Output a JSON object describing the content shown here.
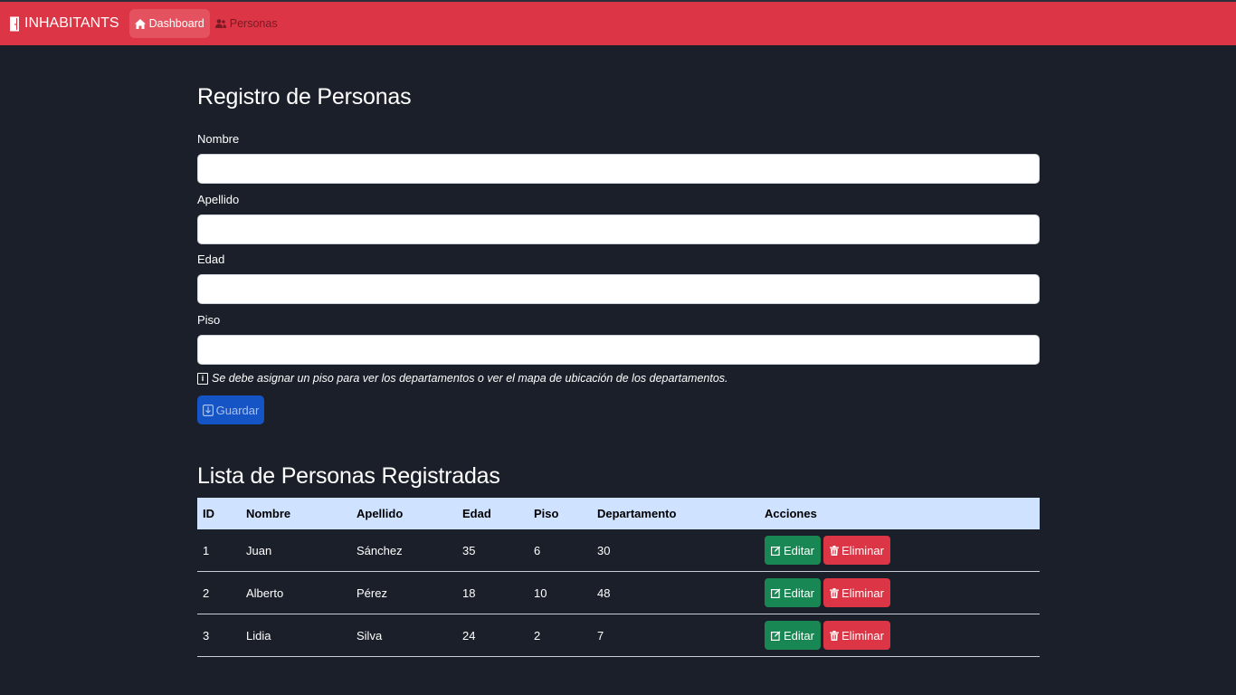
{
  "navbar": {
    "brand": "INHABITANTS",
    "brand_icon": "door-icon",
    "links": [
      {
        "label": "Dashboard",
        "icon": "home-icon",
        "active": true
      },
      {
        "label": "Personas",
        "icon": "people-icon",
        "active": false
      }
    ]
  },
  "form": {
    "title": "Registro de Personas",
    "fields": [
      {
        "label": "Nombre",
        "value": ""
      },
      {
        "label": "Apellido",
        "value": ""
      },
      {
        "label": "Edad",
        "value": ""
      },
      {
        "label": "Piso",
        "value": ""
      }
    ],
    "hint": "Se debe asignar un piso para ver los departamentos o ver el mapa de ubicación de los departamentos.",
    "save_label": "Guardar"
  },
  "list": {
    "title": "Lista de Personas Registradas",
    "columns": [
      "ID",
      "Nombre",
      "Apellido",
      "Edad",
      "Piso",
      "Departamento",
      "Acciones"
    ],
    "rows": [
      {
        "id": "1",
        "nombre": "Juan",
        "apellido": "Sánchez",
        "edad": "35",
        "piso": "6",
        "departamento": "30"
      },
      {
        "id": "2",
        "nombre": "Alberto",
        "apellido": "Pérez",
        "edad": "18",
        "piso": "10",
        "departamento": "48"
      },
      {
        "id": "3",
        "nombre": "Lidia",
        "apellido": "Silva",
        "edad": "24",
        "piso": "2",
        "departamento": "7"
      }
    ],
    "edit_label": "Editar",
    "delete_label": "Eliminar"
  },
  "colors": {
    "navbar": "#dc3545",
    "background": "#1b1f29",
    "primary": "#1554c4",
    "success": "#198754",
    "danger": "#dc3545",
    "table_header": "#cfe2ff"
  }
}
